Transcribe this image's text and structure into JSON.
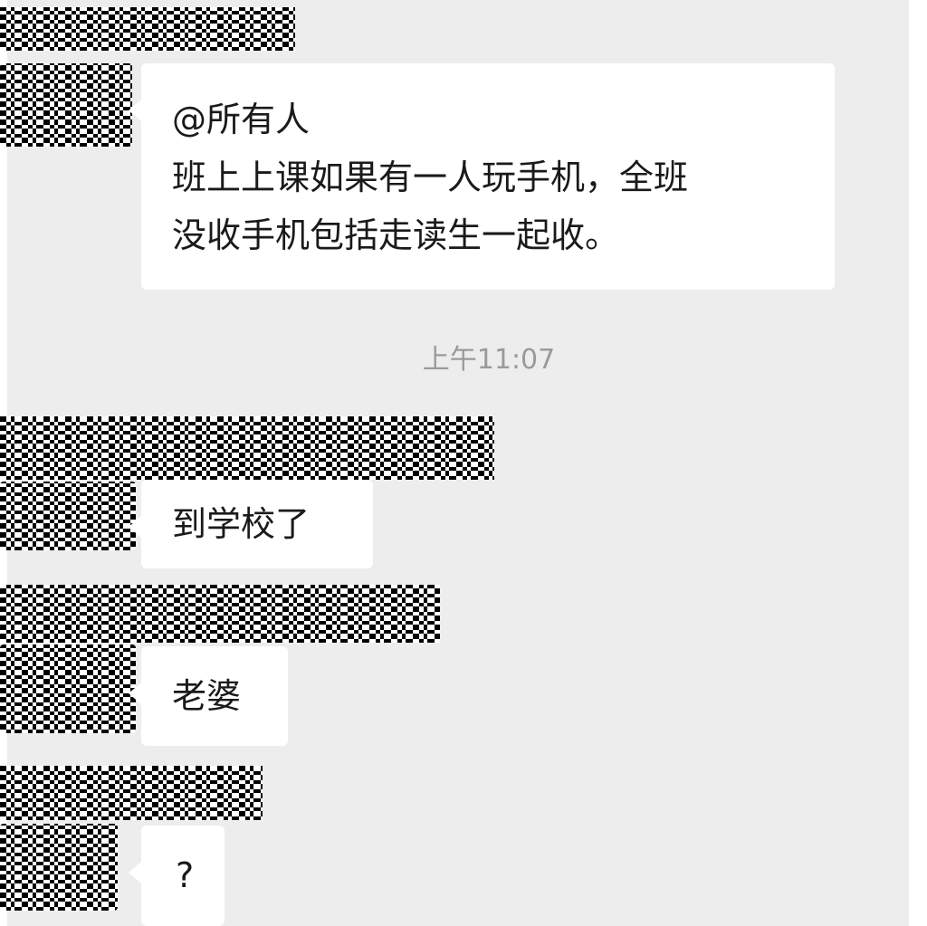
{
  "chat": {
    "timestamp": "上午11:07",
    "messages": [
      {
        "lines": [
          "@所有人",
          "班上上课如果有一人玩手机，全班",
          "没收手机包括走读生一起收。"
        ]
      },
      {
        "lines": [
          "到学校了"
        ]
      },
      {
        "lines": [
          "老婆"
        ]
      },
      {
        "lines": [
          "?"
        ]
      }
    ]
  },
  "colors": {
    "background": "#ededed",
    "bubble": "#ffffff",
    "timestamp": "#9a9a9a",
    "text": "#1a1a1a"
  }
}
